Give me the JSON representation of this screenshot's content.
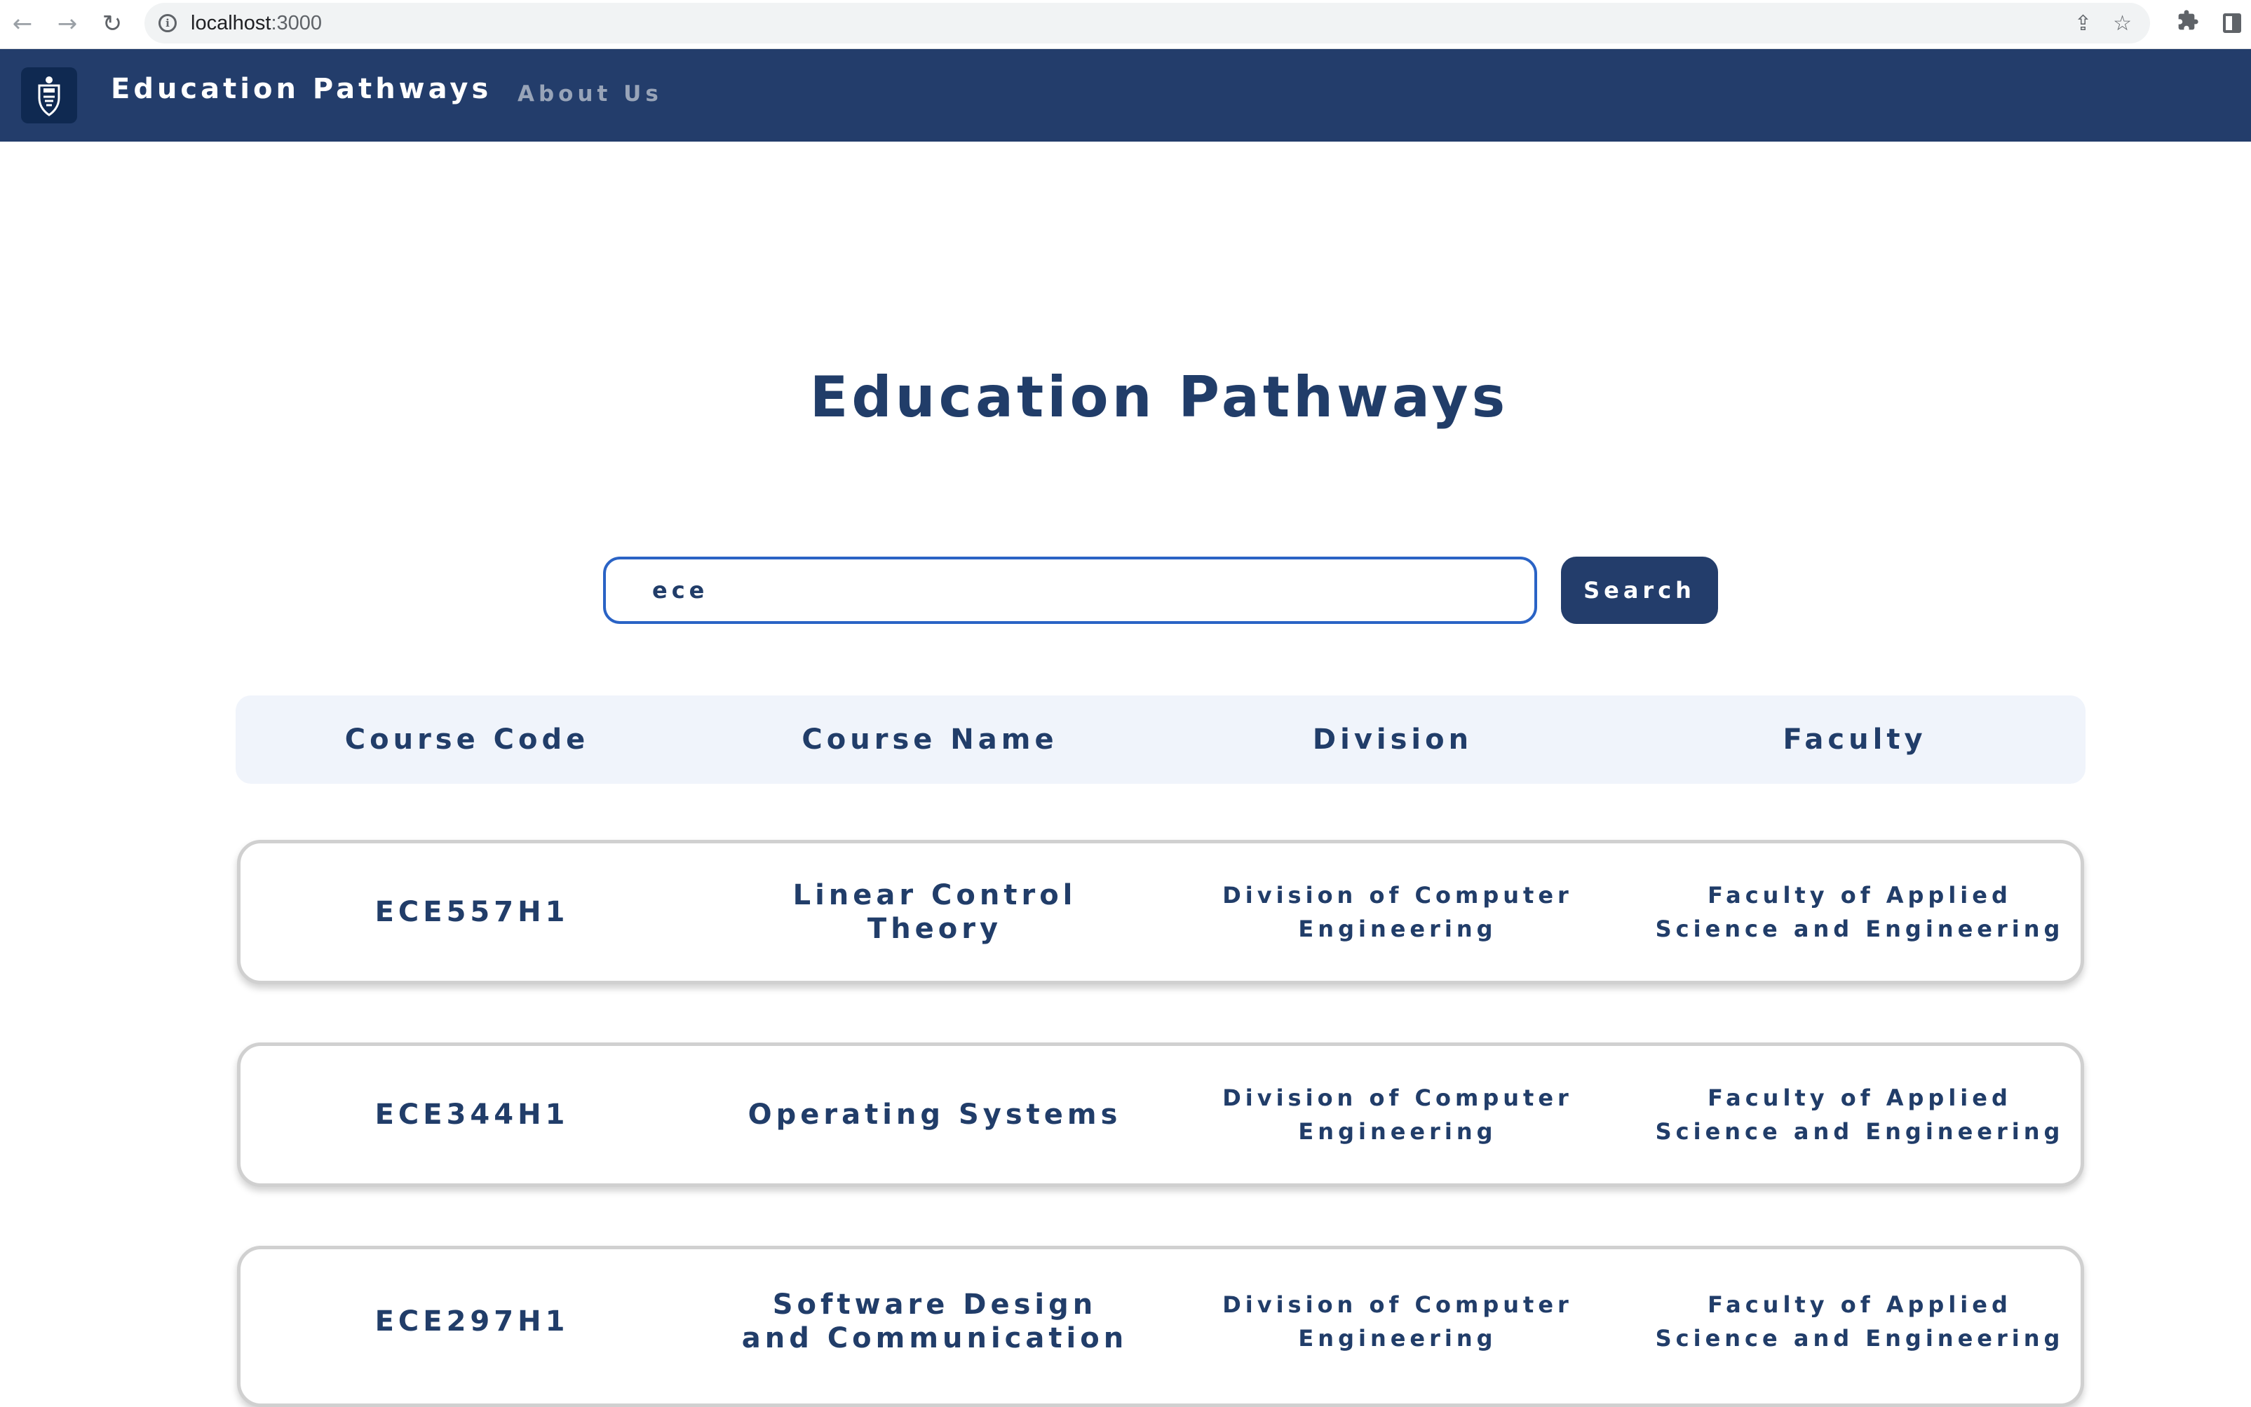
{
  "browser": {
    "url_host": "localhost",
    "url_port": ":3000",
    "back_icon": "arrow-left",
    "forward_icon": "arrow-right",
    "reload_icon": "reload",
    "info_icon": "info-circle",
    "share_icon": "share",
    "bookmark_icon": "star",
    "extensions_icon": "puzzle",
    "side_panel_icon": "side-panel"
  },
  "navbar": {
    "brand": "Education Pathways",
    "about_link": "About Us",
    "logo_icon": "university-crest",
    "background_color": "#233d6b"
  },
  "main": {
    "title": "Education Pathways",
    "search": {
      "value": "ece",
      "button_label": "Search"
    },
    "table": {
      "headers": [
        "Course Code",
        "Course Name",
        "Division",
        "Faculty"
      ],
      "rows": [
        {
          "code": "ECE557H1",
          "name": "Linear Control Theory",
          "division": "Division of Computer Engineering",
          "faculty": "Faculty of Applied Science and Engineering"
        },
        {
          "code": "ECE344H1",
          "name": "Operating Systems",
          "division": "Division of Computer Engineering",
          "faculty": "Faculty of Applied Science and Engineering"
        },
        {
          "code": "ECE297H1",
          "name": "Software Design and Communication",
          "division": "Division of Computer Engineering",
          "faculty": "Faculty of Applied Science and Engineering"
        }
      ]
    }
  },
  "colors": {
    "primary": "#233d6b",
    "text": "#213d69",
    "header_bg": "#f0f4fb",
    "input_border": "#2a63c5"
  }
}
